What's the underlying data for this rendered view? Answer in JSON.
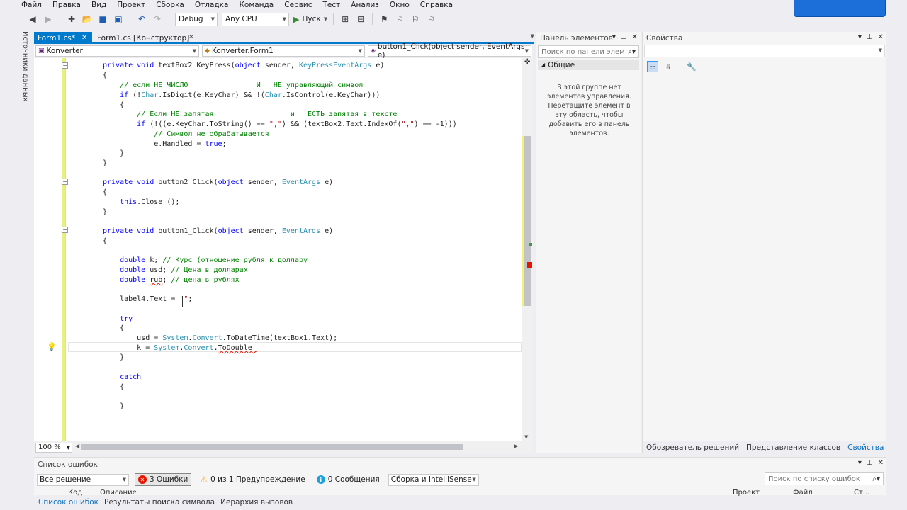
{
  "menu": [
    "Файл",
    "Правка",
    "Вид",
    "Проект",
    "Сборка",
    "Отладка",
    "Команда",
    "Сервис",
    "Тест",
    "Анализ",
    "Окно",
    "Справка"
  ],
  "toolbar": {
    "config": "Debug",
    "platform": "Any CPU",
    "run_label": "Пуск"
  },
  "left_tab": "Источники данных",
  "doc_tabs": [
    {
      "label": "Form1.cs*",
      "active": true
    },
    {
      "label": "Form1.cs [Конструктор]*",
      "active": false
    }
  ],
  "navbar": {
    "project": "Konverter",
    "class": "Konverter.Form1",
    "member": "button1_Click(object sender, EventArgs e)"
  },
  "code": [
    [
      [
        "kw",
        "private void "
      ],
      [
        "",
        "textBox2_KeyPress("
      ],
      [
        "kw",
        "object"
      ],
      [
        "",
        " sender, "
      ],
      [
        "ty",
        "KeyPressEventArgs"
      ],
      [
        "",
        " e)"
      ]
    ],
    [
      [
        "",
        "{"
      ]
    ],
    [
      [
        "cm",
        "    // если НЕ ЧИСЛО                И   НЕ управляющий символ"
      ]
    ],
    [
      [
        "kw",
        "    if"
      ],
      [
        "",
        " (!"
      ],
      [
        "ty",
        "Char"
      ],
      [
        "",
        ".IsDigit(e.KeyChar) && !("
      ],
      [
        "ty",
        "Char"
      ],
      [
        "",
        ".IsControl(e.KeyChar)))"
      ]
    ],
    [
      [
        "",
        "    {"
      ]
    ],
    [
      [
        "cm",
        "        // Если НЕ запятая                  и   ЕСТЬ запятая в тексте"
      ]
    ],
    [
      [
        "kw",
        "        if"
      ],
      [
        "",
        " (!((e.KeyChar.ToString() == "
      ],
      [
        "st",
        "\",\""
      ],
      [
        "",
        ") && (textBox2.Text.IndexOf("
      ],
      [
        "st",
        "\",\""
      ],
      [
        "",
        ") == -1)))"
      ]
    ],
    [
      [
        "cm",
        "            // Символ не обрабатывается"
      ]
    ],
    [
      [
        "",
        "            e.Handled = "
      ],
      [
        "kw",
        "true"
      ],
      [
        "",
        ";"
      ]
    ],
    [
      [
        "",
        "    }"
      ]
    ],
    [
      [
        "",
        "}"
      ]
    ],
    [
      [
        "",
        ""
      ]
    ],
    [
      [
        "kw",
        "private void "
      ],
      [
        "",
        "button2_Click("
      ],
      [
        "kw",
        "object"
      ],
      [
        "",
        " sender, "
      ],
      [
        "ty",
        "EventArgs"
      ],
      [
        "",
        " e)"
      ]
    ],
    [
      [
        "",
        "{"
      ]
    ],
    [
      [
        "kw",
        "    this"
      ],
      [
        "",
        ".Close ();"
      ]
    ],
    [
      [
        "",
        "}"
      ]
    ],
    [
      [
        "",
        ""
      ]
    ],
    [
      [
        "kw",
        "private void "
      ],
      [
        "",
        "button1_Click("
      ],
      [
        "kw",
        "object"
      ],
      [
        "",
        " sender, "
      ],
      [
        "ty",
        "EventArgs"
      ],
      [
        "",
        " e)"
      ]
    ],
    [
      [
        "",
        "{"
      ]
    ],
    [
      [
        "",
        ""
      ]
    ],
    [
      [
        "kw",
        "    double"
      ],
      [
        "",
        " k; "
      ],
      [
        "cm",
        "// Курс (отношение рубля к доллару"
      ]
    ],
    [
      [
        "kw",
        "    double"
      ],
      [
        "",
        " usd; "
      ],
      [
        "cm",
        "// Цена в долларах"
      ]
    ],
    [
      [
        "kw",
        "    double"
      ],
      [
        "",
        " "
      ],
      [
        "err",
        "rub"
      ],
      [
        "",
        "; "
      ],
      [
        "cm",
        "// цена в рублях"
      ]
    ],
    [
      [
        "",
        ""
      ]
    ],
    [
      [
        "",
        "    label4.Text = "
      ],
      [
        "st",
        "\"\""
      ],
      [
        "",
        ";"
      ]
    ],
    [
      [
        "",
        ""
      ]
    ],
    [
      [
        "kw",
        "    try"
      ]
    ],
    [
      [
        "",
        "    {"
      ]
    ],
    [
      [
        "",
        "        usd = "
      ],
      [
        "ty",
        "System"
      ],
      [
        "",
        "."
      ],
      [
        "ty",
        "Convert"
      ],
      [
        "",
        ".ToDateTime(textBox1.Text);"
      ]
    ],
    [
      [
        "",
        "        k = "
      ],
      [
        "ty",
        "System"
      ],
      [
        "",
        "."
      ],
      [
        "ty",
        "Convert"
      ],
      [
        "",
        "."
      ],
      [
        "err",
        "ToDouble"
      ],
      [
        "err",
        " "
      ]
    ],
    [
      [
        "",
        "    }"
      ]
    ],
    [
      [
        "",
        ""
      ]
    ],
    [
      [
        "kw",
        "    catch"
      ]
    ],
    [
      [
        "",
        "    {"
      ]
    ],
    [
      [
        "",
        ""
      ]
    ],
    [
      [
        "",
        "    }"
      ]
    ]
  ],
  "editor_zoom": "100 %",
  "toolbox": {
    "title": "Панель элементов",
    "search_placeholder": "Поиск по панели элем",
    "group": "Общие",
    "empty_text": "В этой группе нет элементов управления. Перетащите элемент в эту область, чтобы добавить его в панель элементов."
  },
  "properties": {
    "title": "Свойства",
    "tabs": [
      {
        "label": "Обозреватель решений",
        "active": false
      },
      {
        "label": "Представление классов",
        "active": false
      },
      {
        "label": "Свойства",
        "active": true
      }
    ]
  },
  "errorlist": {
    "title": "Список ошибок",
    "scope": "Все решение",
    "errors": "3 Ошибки",
    "warnings": "0 из 1 Предупреждение",
    "messages": "0 Сообщения",
    "build": "Сборка и IntelliSense",
    "search_placeholder": "Поиск по списку ошибок",
    "columns": [
      "Код",
      "Описание",
      "Проект",
      "Файл",
      "Ст..."
    ]
  },
  "bottom_tabs": [
    {
      "label": "Список ошибок",
      "active": true
    },
    {
      "label": "Результаты поиска символа",
      "active": false
    },
    {
      "label": "Иерархия вызовов",
      "active": false
    }
  ],
  "icons": [
    "back-icon",
    "forward-icon",
    "new-project-icon",
    "open-icon",
    "save-icon",
    "save-all-icon",
    "undo-icon",
    "redo-icon",
    "play-icon",
    "pin-icon",
    "close-icon",
    "dropdown-icon",
    "search-icon",
    "lightbulb-icon",
    "categorized-icon",
    "alphabetical-icon",
    "wrench-icon"
  ],
  "colors": {
    "accent": "#007acc",
    "keyword": "#0000ff",
    "type": "#2b91af",
    "comment": "#008000",
    "error": "#e51400"
  }
}
